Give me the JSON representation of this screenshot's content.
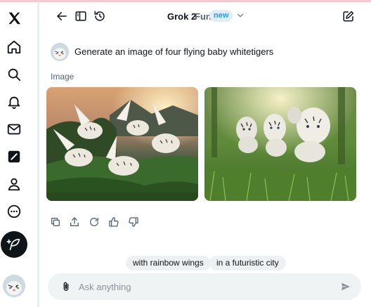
{
  "header": {
    "model": "Grok 2",
    "mode": "Fun",
    "badge": "new"
  },
  "nav": {
    "items": [
      "home-icon",
      "search-icon",
      "bell-icon",
      "mail-icon",
      "grok-icon",
      "person-icon",
      "more-circle-icon"
    ],
    "compose_icon": "feather-plus-icon"
  },
  "message": {
    "text": "Generate an image of four flying baby whitetigers",
    "label": "Image"
  },
  "actions": [
    "copy-icon",
    "share-icon",
    "regenerate-icon",
    "thumbs-up-icon",
    "thumbs-down-icon"
  ],
  "suggestions": [
    "with rainbow wings",
    "in a futuristic city"
  ],
  "input": {
    "placeholder": "Ask anything"
  },
  "colors": {
    "accent": "#1d9bf0",
    "text": "#0f1419",
    "muted": "#536471",
    "input_bg": "#eff3f4"
  }
}
